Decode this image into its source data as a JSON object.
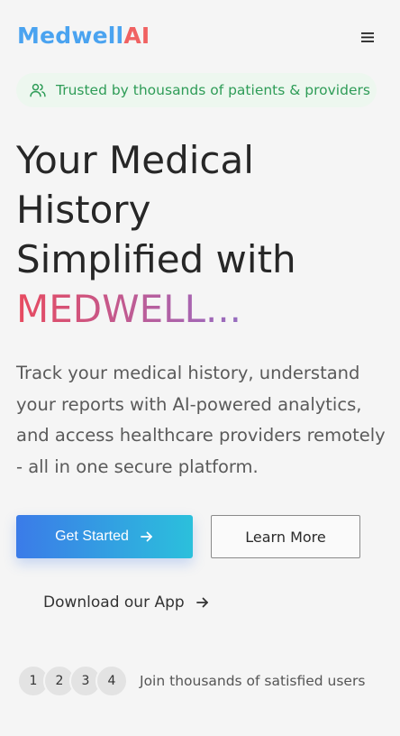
{
  "header": {
    "logo_part1": "Medwell",
    "logo_part2": "AI",
    "menu_icon": "hamburger-menu-icon"
  },
  "badge": {
    "icon": "users-icon",
    "text": "Trusted by thousands of patients & providers"
  },
  "hero": {
    "title_lines": [
      "Your Medical",
      "History",
      "Simplified with"
    ],
    "title_brand": "MEDWELL...",
    "description": "Track your medical history, understand your reports with AI-powered analytics, and access healthcare providers remotely - all in one secure platform."
  },
  "actions": {
    "get_started": "Get Started",
    "learn_more": "Learn More",
    "download": "Download our App",
    "arrow_icon": "arrow-right-icon"
  },
  "social_proof": {
    "avatars": [
      "1",
      "2",
      "3",
      "4"
    ],
    "text": "Join thousands of satisfied users"
  },
  "colors": {
    "logo_blue": "#4aa3f0",
    "logo_red": "#f06262",
    "badge_green": "#2e9c57",
    "badge_bg": "#edf7ef",
    "gradient_start": "#3b7be8",
    "gradient_end": "#2bc0dc"
  }
}
